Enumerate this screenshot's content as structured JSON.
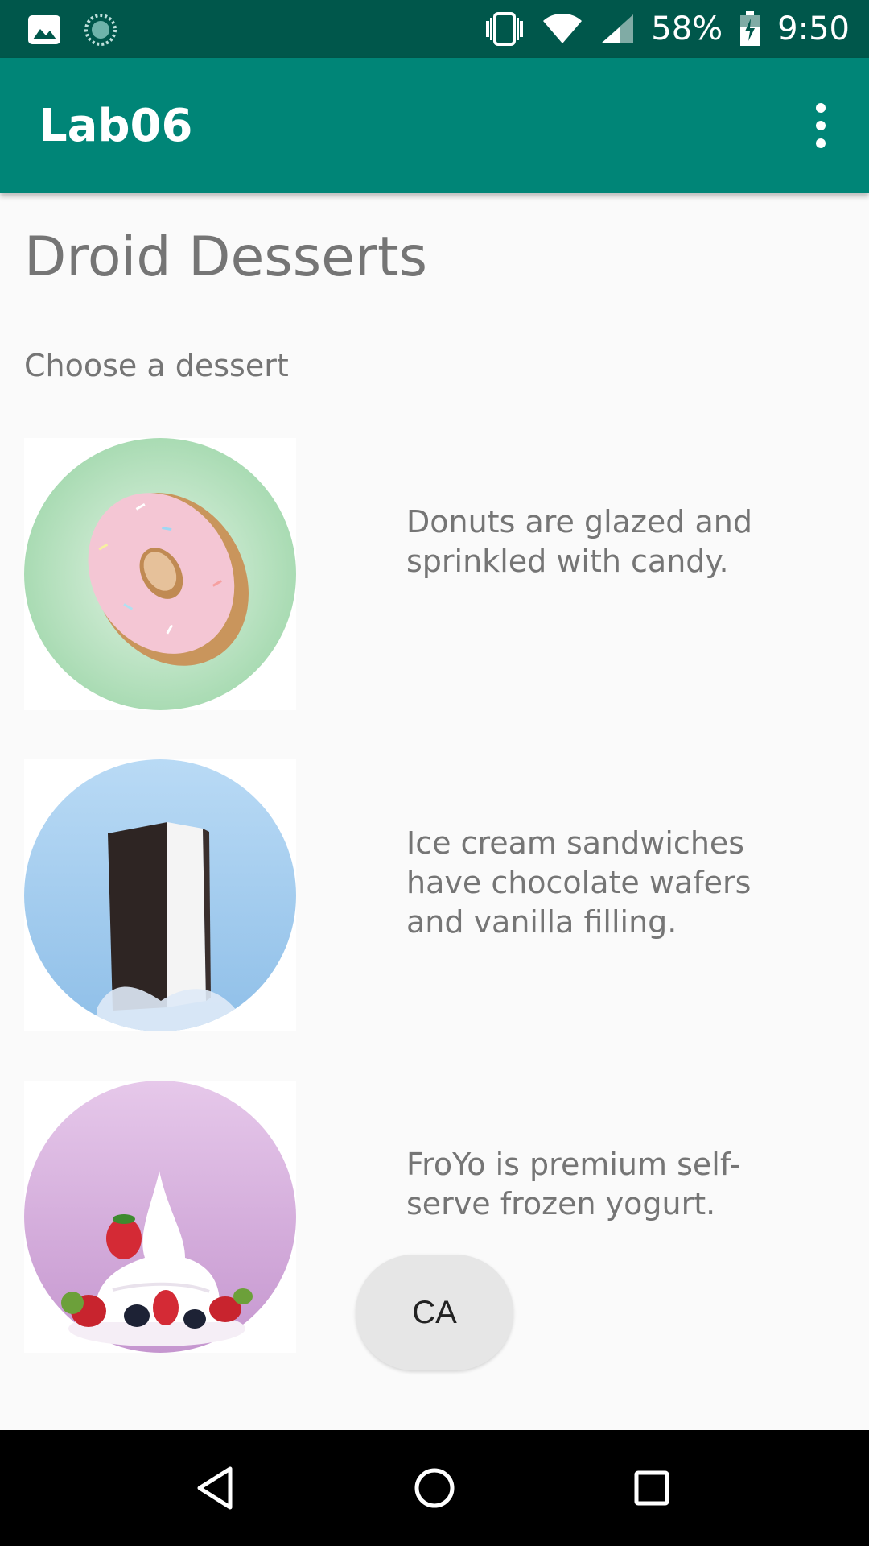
{
  "status_bar": {
    "battery": "58%",
    "time": "9:50",
    "icons": [
      "image-icon",
      "loading-icon",
      "vibrate-icon",
      "wifi-icon",
      "signal-icon",
      "battery-icon"
    ]
  },
  "app_bar": {
    "title": "Lab06",
    "menu_icon": "more-vert-icon"
  },
  "content": {
    "title": "Droid Desserts",
    "subtitle": "Choose a dessert",
    "items": [
      {
        "image": "donut",
        "text": "Donuts are glazed and sprinkled with candy."
      },
      {
        "image": "ice-cream-sandwich",
        "text": "Ice cream sandwiches have chocolate wafers and vanilla filling."
      },
      {
        "image": "froyo",
        "text": "FroYo is premium self-serve frozen yogurt."
      }
    ],
    "button_label": "CA"
  },
  "nav_bar": {
    "icons": [
      "back-icon",
      "home-icon",
      "recents-icon"
    ]
  },
  "colors": {
    "primary": "#008577",
    "primary_dark": "#00574b",
    "background": "#fafafa",
    "text_secondary": "#757575"
  }
}
